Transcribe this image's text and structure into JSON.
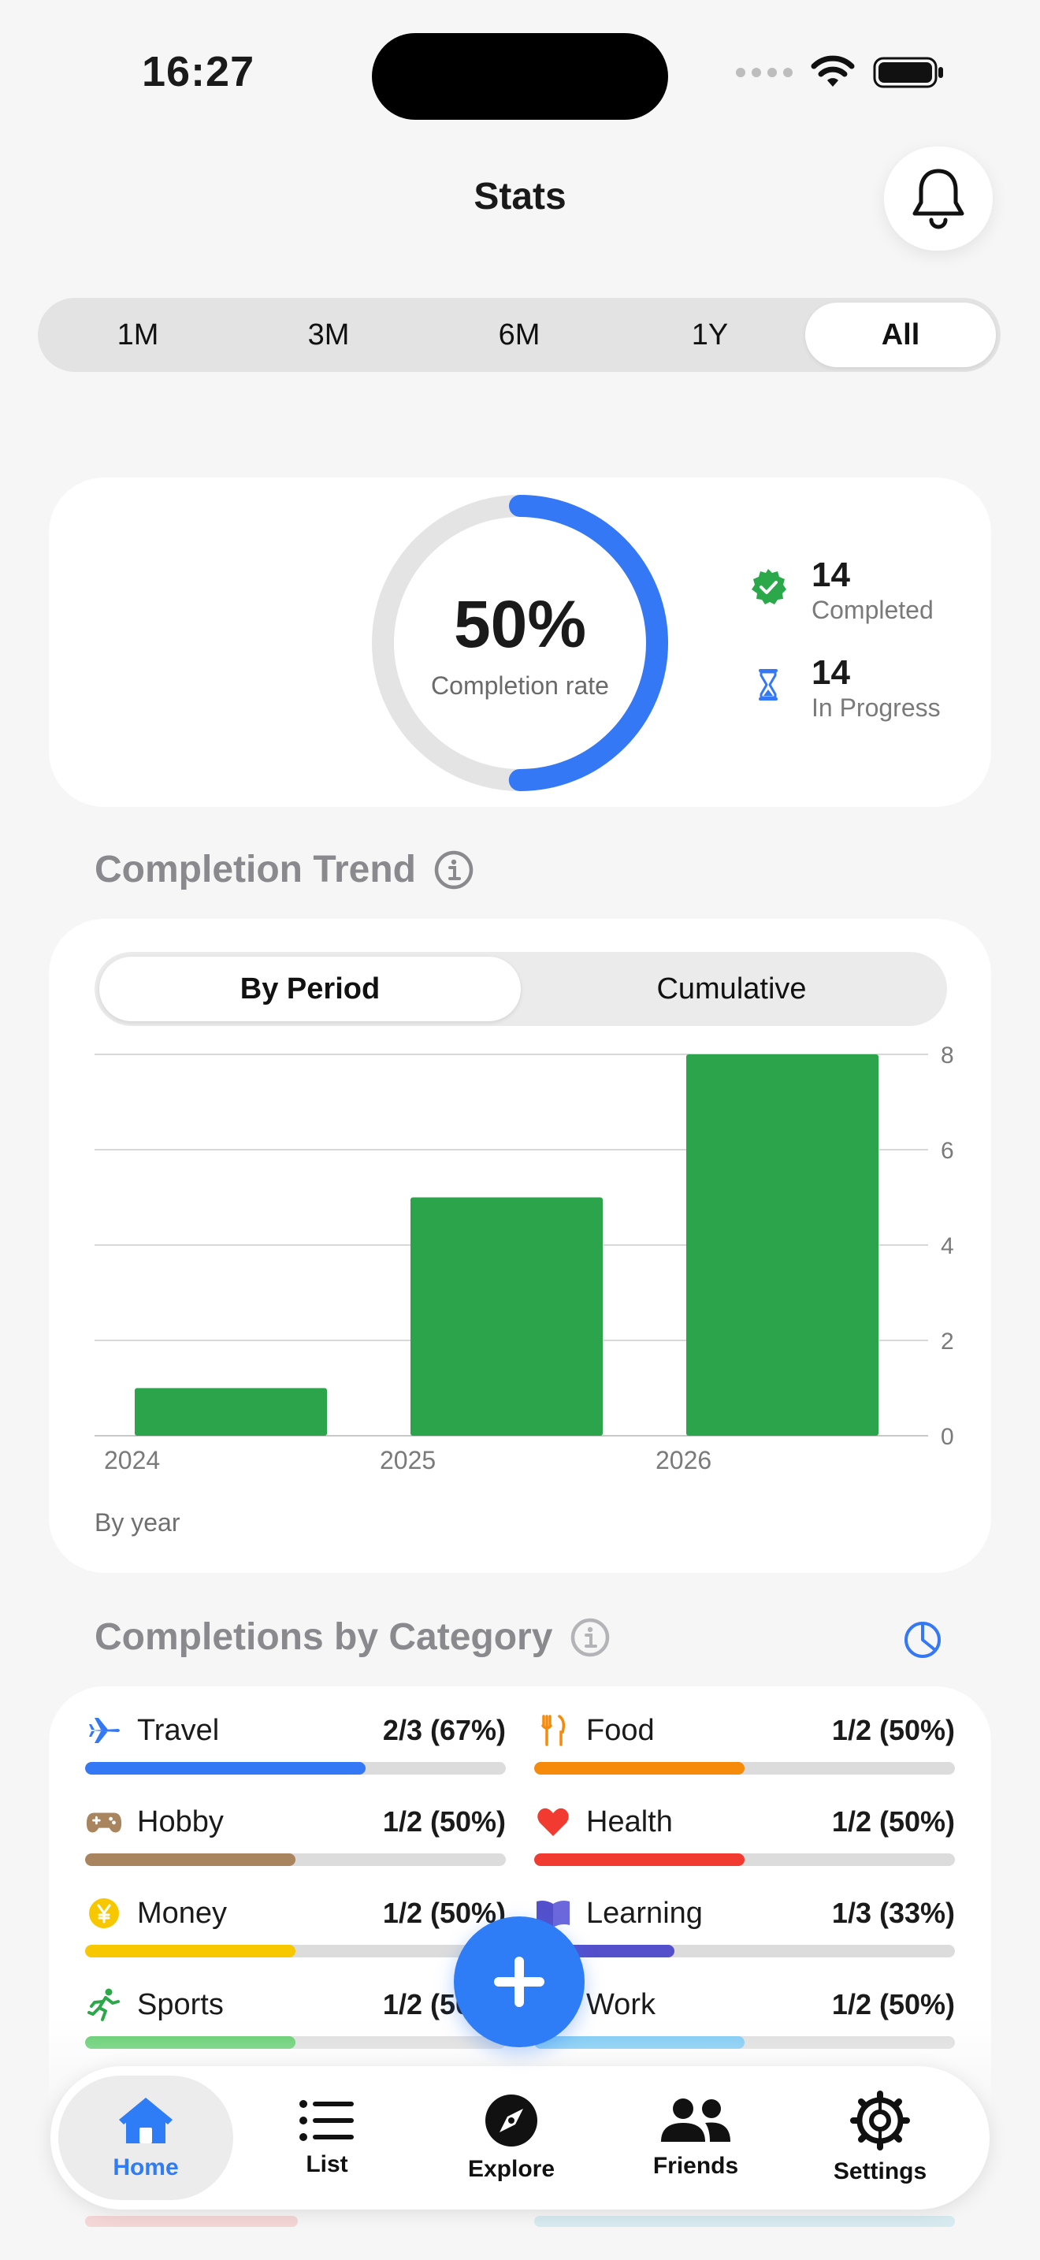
{
  "status_bar": {
    "time": "16:27"
  },
  "header": {
    "title": "Stats"
  },
  "periods": [
    {
      "label": "1M",
      "active": false
    },
    {
      "label": "3M",
      "active": false
    },
    {
      "label": "6M",
      "active": false
    },
    {
      "label": "1Y",
      "active": false
    },
    {
      "label": "All",
      "active": true
    }
  ],
  "summary": {
    "completion_rate": "50%",
    "completion_rate_label": "Completion rate",
    "completion_fraction": 0.5,
    "completed_count": "14",
    "completed_label": "Completed",
    "in_progress_count": "14",
    "in_progress_label": "In Progress",
    "accent_color": "#3478f6",
    "completed_color": "#2aa84a"
  },
  "trend": {
    "title": "Completion Trend",
    "modes": [
      {
        "label": "By Period",
        "active": true
      },
      {
        "label": "Cumulative",
        "active": false
      }
    ],
    "footnote": "By year"
  },
  "chart_data": {
    "type": "bar",
    "categories": [
      "2024",
      "2025",
      "2026"
    ],
    "values": [
      1,
      5,
      8
    ],
    "ylim": [
      0,
      8
    ],
    "yticks": [
      0,
      2,
      4,
      6,
      8
    ],
    "title": "",
    "xlabel": "",
    "ylabel": "",
    "color": "#2ca44b",
    "grid": true
  },
  "categories_section": {
    "title": "Completions by Category",
    "items": [
      {
        "name": "Travel",
        "value": "2/3 (67%)",
        "fraction": 0.667,
        "color": "#3478f6",
        "icon": "airplane-icon"
      },
      {
        "name": "Food",
        "value": "1/2 (50%)",
        "fraction": 0.5,
        "color": "#f58a0b",
        "icon": "fork-knife-icon"
      },
      {
        "name": "Hobby",
        "value": "1/2 (50%)",
        "fraction": 0.5,
        "color": "#a8845f",
        "icon": "game-controller-icon"
      },
      {
        "name": "Health",
        "value": "1/2 (50%)",
        "fraction": 0.5,
        "color": "#f23b30",
        "icon": "heart-icon"
      },
      {
        "name": "Money",
        "value": "1/2 (50%)",
        "fraction": 0.5,
        "color": "#f7c800",
        "icon": "yen-coin-icon"
      },
      {
        "name": "Learning",
        "value": "1/3 (33%)",
        "fraction": 0.333,
        "color": "#5450cc",
        "icon": "book-icon"
      },
      {
        "name": "Sports",
        "value": "1/2 (50%)",
        "fraction": 0.5,
        "color": "#4fc95e",
        "icon": "running-icon"
      },
      {
        "name": "Work",
        "value": "1/2 (50%)",
        "fraction": 0.5,
        "color": "#6ec5f4",
        "icon": "briefcase-icon"
      }
    ]
  },
  "tab_bar": {
    "tabs": [
      {
        "label": "Home",
        "icon": "house-icon",
        "active": true
      },
      {
        "label": "List",
        "icon": "list-icon",
        "active": false
      },
      {
        "label": "Explore",
        "icon": "compass-icon",
        "active": false
      },
      {
        "label": "Friends",
        "icon": "people-icon",
        "active": false
      },
      {
        "label": "Settings",
        "icon": "gear-icon",
        "active": false
      }
    ]
  }
}
